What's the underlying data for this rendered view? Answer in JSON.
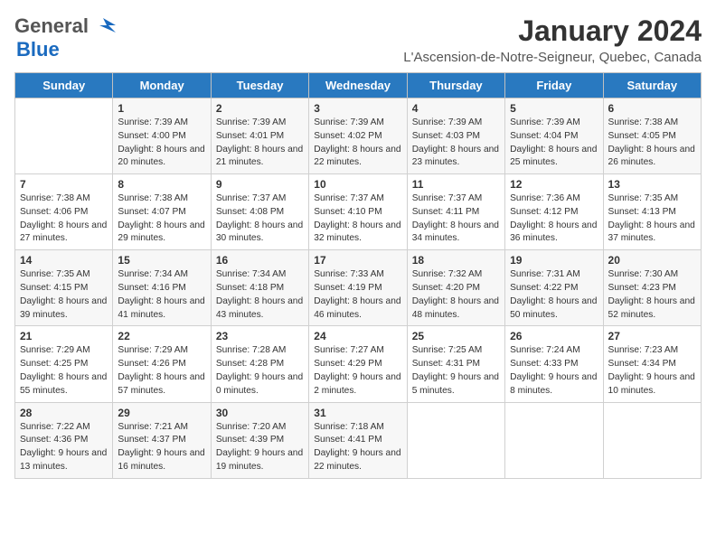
{
  "header": {
    "logo_general": "General",
    "logo_blue": "Blue",
    "month_title": "January 2024",
    "location": "L'Ascension-de-Notre-Seigneur, Quebec, Canada"
  },
  "days_of_week": [
    "Sunday",
    "Monday",
    "Tuesday",
    "Wednesday",
    "Thursday",
    "Friday",
    "Saturday"
  ],
  "weeks": [
    [
      {
        "day": "",
        "info": ""
      },
      {
        "day": "1",
        "info": "Sunrise: 7:39 AM\nSunset: 4:00 PM\nDaylight: 8 hours and 20 minutes."
      },
      {
        "day": "2",
        "info": "Sunrise: 7:39 AM\nSunset: 4:01 PM\nDaylight: 8 hours and 21 minutes."
      },
      {
        "day": "3",
        "info": "Sunrise: 7:39 AM\nSunset: 4:02 PM\nDaylight: 8 hours and 22 minutes."
      },
      {
        "day": "4",
        "info": "Sunrise: 7:39 AM\nSunset: 4:03 PM\nDaylight: 8 hours and 23 minutes."
      },
      {
        "day": "5",
        "info": "Sunrise: 7:39 AM\nSunset: 4:04 PM\nDaylight: 8 hours and 25 minutes."
      },
      {
        "day": "6",
        "info": "Sunrise: 7:38 AM\nSunset: 4:05 PM\nDaylight: 8 hours and 26 minutes."
      }
    ],
    [
      {
        "day": "7",
        "info": "Sunrise: 7:38 AM\nSunset: 4:06 PM\nDaylight: 8 hours and 27 minutes."
      },
      {
        "day": "8",
        "info": "Sunrise: 7:38 AM\nSunset: 4:07 PM\nDaylight: 8 hours and 29 minutes."
      },
      {
        "day": "9",
        "info": "Sunrise: 7:37 AM\nSunset: 4:08 PM\nDaylight: 8 hours and 30 minutes."
      },
      {
        "day": "10",
        "info": "Sunrise: 7:37 AM\nSunset: 4:10 PM\nDaylight: 8 hours and 32 minutes."
      },
      {
        "day": "11",
        "info": "Sunrise: 7:37 AM\nSunset: 4:11 PM\nDaylight: 8 hours and 34 minutes."
      },
      {
        "day": "12",
        "info": "Sunrise: 7:36 AM\nSunset: 4:12 PM\nDaylight: 8 hours and 36 minutes."
      },
      {
        "day": "13",
        "info": "Sunrise: 7:35 AM\nSunset: 4:13 PM\nDaylight: 8 hours and 37 minutes."
      }
    ],
    [
      {
        "day": "14",
        "info": "Sunrise: 7:35 AM\nSunset: 4:15 PM\nDaylight: 8 hours and 39 minutes."
      },
      {
        "day": "15",
        "info": "Sunrise: 7:34 AM\nSunset: 4:16 PM\nDaylight: 8 hours and 41 minutes."
      },
      {
        "day": "16",
        "info": "Sunrise: 7:34 AM\nSunset: 4:18 PM\nDaylight: 8 hours and 43 minutes."
      },
      {
        "day": "17",
        "info": "Sunrise: 7:33 AM\nSunset: 4:19 PM\nDaylight: 8 hours and 46 minutes."
      },
      {
        "day": "18",
        "info": "Sunrise: 7:32 AM\nSunset: 4:20 PM\nDaylight: 8 hours and 48 minutes."
      },
      {
        "day": "19",
        "info": "Sunrise: 7:31 AM\nSunset: 4:22 PM\nDaylight: 8 hours and 50 minutes."
      },
      {
        "day": "20",
        "info": "Sunrise: 7:30 AM\nSunset: 4:23 PM\nDaylight: 8 hours and 52 minutes."
      }
    ],
    [
      {
        "day": "21",
        "info": "Sunrise: 7:29 AM\nSunset: 4:25 PM\nDaylight: 8 hours and 55 minutes."
      },
      {
        "day": "22",
        "info": "Sunrise: 7:29 AM\nSunset: 4:26 PM\nDaylight: 8 hours and 57 minutes."
      },
      {
        "day": "23",
        "info": "Sunrise: 7:28 AM\nSunset: 4:28 PM\nDaylight: 9 hours and 0 minutes."
      },
      {
        "day": "24",
        "info": "Sunrise: 7:27 AM\nSunset: 4:29 PM\nDaylight: 9 hours and 2 minutes."
      },
      {
        "day": "25",
        "info": "Sunrise: 7:25 AM\nSunset: 4:31 PM\nDaylight: 9 hours and 5 minutes."
      },
      {
        "day": "26",
        "info": "Sunrise: 7:24 AM\nSunset: 4:33 PM\nDaylight: 9 hours and 8 minutes."
      },
      {
        "day": "27",
        "info": "Sunrise: 7:23 AM\nSunset: 4:34 PM\nDaylight: 9 hours and 10 minutes."
      }
    ],
    [
      {
        "day": "28",
        "info": "Sunrise: 7:22 AM\nSunset: 4:36 PM\nDaylight: 9 hours and 13 minutes."
      },
      {
        "day": "29",
        "info": "Sunrise: 7:21 AM\nSunset: 4:37 PM\nDaylight: 9 hours and 16 minutes."
      },
      {
        "day": "30",
        "info": "Sunrise: 7:20 AM\nSunset: 4:39 PM\nDaylight: 9 hours and 19 minutes."
      },
      {
        "day": "31",
        "info": "Sunrise: 7:18 AM\nSunset: 4:41 PM\nDaylight: 9 hours and 22 minutes."
      },
      {
        "day": "",
        "info": ""
      },
      {
        "day": "",
        "info": ""
      },
      {
        "day": "",
        "info": ""
      }
    ]
  ]
}
